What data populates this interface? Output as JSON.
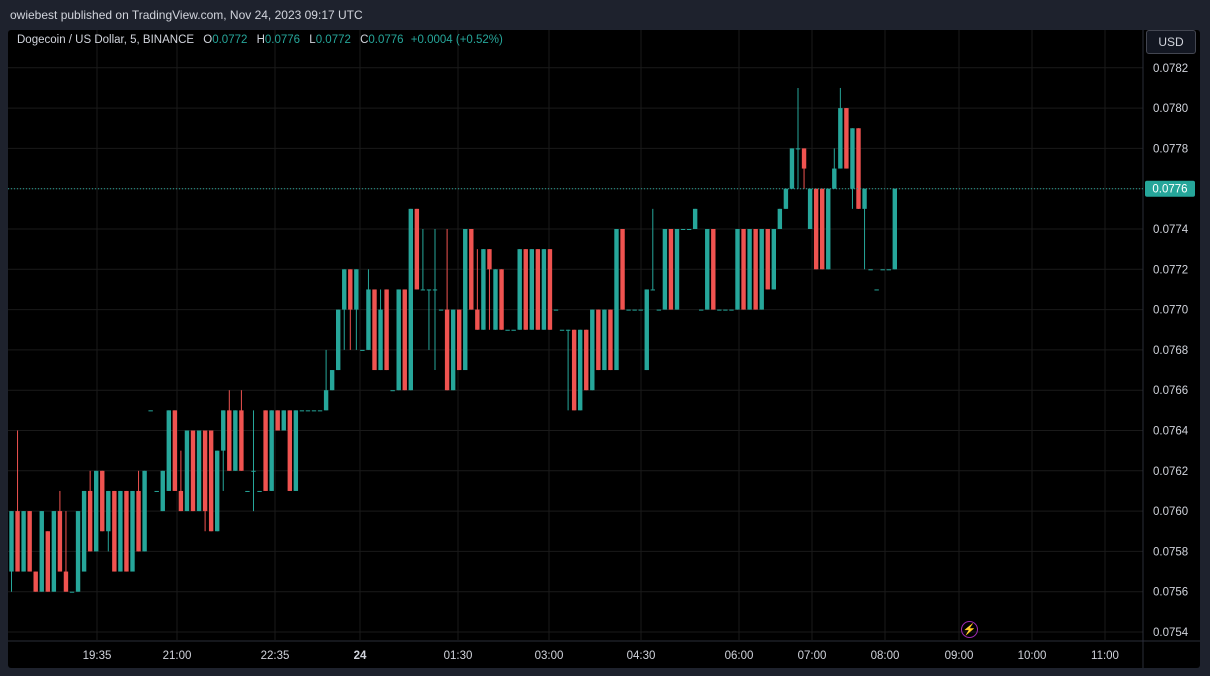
{
  "header": {
    "published": "owiebest published on TradingView.com, Nov 24, 2023 09:17 UTC"
  },
  "legend": {
    "symbol": "Dogecoin / US Dollar, 5, BINANCE",
    "o_label": "O",
    "o": "0.0772",
    "h_label": "H",
    "h": "0.0776",
    "l_label": "L",
    "l": "0.0772",
    "c_label": "C",
    "c": "0.0776",
    "change": "+0.0004 (+0.52%)"
  },
  "currency_button": "USD",
  "last_price_label": "0.0776",
  "colors": {
    "up": "#26a69a",
    "down": "#ef5350",
    "background": "#000000",
    "grid": "#1a1a1a"
  },
  "icons": {
    "bolt": "lightning-bolt-icon"
  },
  "chart_data": {
    "type": "candlestick",
    "interval": "5",
    "exchange": "BINANCE",
    "ylim": [
      0.0753,
      0.0783
    ],
    "y_ticks": [
      "0.0754",
      "0.0756",
      "0.0758",
      "0.0760",
      "0.0762",
      "0.0764",
      "0.0766",
      "0.0768",
      "0.0770",
      "0.0772",
      "0.0774",
      "0.0776",
      "0.0778",
      "0.0780",
      "0.0782"
    ],
    "x_ticks": [
      "19:35",
      "21:00",
      "22:35",
      "24",
      "01:30",
      "03:00",
      "04:30",
      "06:00",
      "07:00",
      "08:00",
      "09:00",
      "10:00",
      "11:00"
    ],
    "last_price": 0.0776,
    "candles": [
      [
        0.0757,
        0.076,
        0.0756,
        0.076
      ],
      [
        0.076,
        0.0764,
        0.0757,
        0.0757
      ],
      [
        0.0757,
        0.076,
        0.0757,
        0.076
      ],
      [
        0.076,
        0.076,
        0.0757,
        0.0757
      ],
      [
        0.0757,
        0.0757,
        0.0756,
        0.0756
      ],
      [
        0.0756,
        0.076,
        0.0756,
        0.076
      ],
      [
        0.0759,
        0.0759,
        0.0756,
        0.0756
      ],
      [
        0.0756,
        0.076,
        0.0756,
        0.076
      ],
      [
        0.076,
        0.0761,
        0.0757,
        0.0757
      ],
      [
        0.0757,
        0.076,
        0.0756,
        0.0756
      ],
      [
        0.0756,
        0.0756,
        0.0756,
        0.0756
      ],
      [
        0.0756,
        0.076,
        0.0756,
        0.076
      ],
      [
        0.0757,
        0.0761,
        0.0757,
        0.0761
      ],
      [
        0.0761,
        0.0762,
        0.0758,
        0.0758
      ],
      [
        0.0758,
        0.0762,
        0.0758,
        0.0762
      ],
      [
        0.0762,
        0.0762,
        0.0759,
        0.0759
      ],
      [
        0.0759,
        0.0761,
        0.0758,
        0.0761
      ],
      [
        0.0761,
        0.0761,
        0.0757,
        0.0757
      ],
      [
        0.0757,
        0.0761,
        0.0757,
        0.0761
      ],
      [
        0.0761,
        0.0761,
        0.0757,
        0.0757
      ],
      [
        0.0757,
        0.0761,
        0.0757,
        0.0761
      ],
      [
        0.0761,
        0.0762,
        0.0758,
        0.0758
      ],
      [
        0.0758,
        0.0762,
        0.0758,
        0.0762
      ],
      [
        0.0765,
        0.0765,
        0.0765,
        0.0765
      ],
      [
        0.0761,
        0.0761,
        0.0761,
        0.0761
      ],
      [
        0.076,
        0.0762,
        0.076,
        0.0762
      ],
      [
        0.0761,
        0.0765,
        0.0761,
        0.0765
      ],
      [
        0.0765,
        0.0765,
        0.0761,
        0.0761
      ],
      [
        0.0761,
        0.0763,
        0.076,
        0.076
      ],
      [
        0.076,
        0.0764,
        0.076,
        0.0764
      ],
      [
        0.0764,
        0.0764,
        0.076,
        0.076
      ],
      [
        0.076,
        0.0764,
        0.076,
        0.0764
      ],
      [
        0.0764,
        0.0764,
        0.0759,
        0.076
      ],
      [
        0.0764,
        0.0764,
        0.0759,
        0.0759
      ],
      [
        0.0759,
        0.0763,
        0.0759,
        0.0763
      ],
      [
        0.0763,
        0.0765,
        0.0761,
        0.0765
      ],
      [
        0.0765,
        0.0766,
        0.0762,
        0.0762
      ],
      [
        0.0762,
        0.0765,
        0.0762,
        0.0765
      ],
      [
        0.0765,
        0.0766,
        0.0762,
        0.0762
      ],
      [
        0.0761,
        0.0761,
        0.0761,
        0.0761
      ],
      [
        0.0762,
        0.0765,
        0.076,
        0.0762
      ],
      [
        0.0761,
        0.0761,
        0.0761,
        0.0761
      ],
      [
        0.0765,
        0.0765,
        0.0761,
        0.0761
      ],
      [
        0.0761,
        0.0765,
        0.0761,
        0.0765
      ],
      [
        0.0765,
        0.0765,
        0.0764,
        0.0764
      ],
      [
        0.0764,
        0.0765,
        0.0764,
        0.0765
      ],
      [
        0.0765,
        0.0765,
        0.0761,
        0.0761
      ],
      [
        0.0761,
        0.0765,
        0.0761,
        0.0765
      ],
      [
        0.0765,
        0.0765,
        0.0765,
        0.0765
      ],
      [
        0.0765,
        0.0765,
        0.0765,
        0.0765
      ],
      [
        0.0765,
        0.0765,
        0.0765,
        0.0765
      ],
      [
        0.0765,
        0.0765,
        0.0765,
        0.0765
      ],
      [
        0.0765,
        0.0768,
        0.0765,
        0.0766
      ],
      [
        0.0766,
        0.0767,
        0.0766,
        0.0767
      ],
      [
        0.0767,
        0.077,
        0.0767,
        0.077
      ],
      [
        0.077,
        0.0772,
        0.0768,
        0.0772
      ],
      [
        0.0772,
        0.0772,
        0.0768,
        0.077
      ],
      [
        0.077,
        0.0772,
        0.0768,
        0.0772
      ],
      [
        0.0768,
        0.0768,
        0.0768,
        0.0768
      ],
      [
        0.0768,
        0.0772,
        0.0768,
        0.0771
      ],
      [
        0.0771,
        0.0771,
        0.0767,
        0.0767
      ],
      [
        0.0767,
        0.0771,
        0.0767,
        0.077
      ],
      [
        0.0771,
        0.0771,
        0.0767,
        0.0767
      ],
      [
        0.0766,
        0.0766,
        0.0766,
        0.0766
      ],
      [
        0.0766,
        0.0771,
        0.0766,
        0.0771
      ],
      [
        0.0771,
        0.0771,
        0.0766,
        0.0766
      ],
      [
        0.0766,
        0.0775,
        0.0766,
        0.0775
      ],
      [
        0.0775,
        0.0775,
        0.0771,
        0.0771
      ],
      [
        0.0771,
        0.0774,
        0.0771,
        0.0771
      ],
      [
        0.0771,
        0.0771,
        0.0768,
        0.0771
      ],
      [
        0.0771,
        0.0774,
        0.0767,
        0.0771
      ],
      [
        0.077,
        0.077,
        0.077,
        0.077
      ],
      [
        0.077,
        0.0774,
        0.0766,
        0.0766
      ],
      [
        0.0766,
        0.077,
        0.0766,
        0.077
      ],
      [
        0.077,
        0.077,
        0.0767,
        0.0767
      ],
      [
        0.0767,
        0.0774,
        0.0767,
        0.0774
      ],
      [
        0.0774,
        0.0774,
        0.077,
        0.077
      ],
      [
        0.077,
        0.0773,
        0.0769,
        0.0769
      ],
      [
        0.0769,
        0.0773,
        0.0769,
        0.0773
      ],
      [
        0.0773,
        0.0773,
        0.0769,
        0.0772
      ],
      [
        0.0769,
        0.0772,
        0.0769,
        0.0772
      ],
      [
        0.0772,
        0.0772,
        0.0769,
        0.0769
      ],
      [
        0.0769,
        0.0769,
        0.0769,
        0.0769
      ],
      [
        0.0769,
        0.0769,
        0.0769,
        0.0769
      ],
      [
        0.0769,
        0.0773,
        0.0769,
        0.0773
      ],
      [
        0.0773,
        0.0773,
        0.0769,
        0.0769
      ],
      [
        0.0769,
        0.0773,
        0.0769,
        0.0773
      ],
      [
        0.0773,
        0.0773,
        0.0769,
        0.0769
      ],
      [
        0.0769,
        0.0773,
        0.0769,
        0.0773
      ],
      [
        0.0773,
        0.0773,
        0.0769,
        0.0769
      ],
      [
        0.077,
        0.077,
        0.077,
        0.077
      ],
      [
        0.0769,
        0.0769,
        0.0769,
        0.0769
      ],
      [
        0.0769,
        0.0769,
        0.0765,
        0.0769
      ],
      [
        0.0769,
        0.0769,
        0.0765,
        0.0765
      ],
      [
        0.0765,
        0.0769,
        0.0765,
        0.0769
      ],
      [
        0.0769,
        0.0769,
        0.0766,
        0.0766
      ],
      [
        0.0766,
        0.077,
        0.0766,
        0.077
      ],
      [
        0.077,
        0.077,
        0.0767,
        0.0767
      ],
      [
        0.0767,
        0.077,
        0.0767,
        0.077
      ],
      [
        0.077,
        0.077,
        0.0767,
        0.0767
      ],
      [
        0.0767,
        0.0774,
        0.0767,
        0.0774
      ],
      [
        0.0774,
        0.0774,
        0.077,
        0.077
      ],
      [
        0.077,
        0.077,
        0.077,
        0.077
      ],
      [
        0.077,
        0.077,
        0.077,
        0.077
      ],
      [
        0.077,
        0.077,
        0.077,
        0.077
      ],
      [
        0.0767,
        0.0771,
        0.0767,
        0.0771
      ],
      [
        0.0771,
        0.0775,
        0.0771,
        0.0771
      ],
      [
        0.077,
        0.077,
        0.077,
        0.077
      ],
      [
        0.077,
        0.0774,
        0.077,
        0.0774
      ],
      [
        0.0774,
        0.0774,
        0.077,
        0.077
      ],
      [
        0.077,
        0.0774,
        0.077,
        0.0774
      ],
      [
        0.0774,
        0.0774,
        0.0774,
        0.0774
      ],
      [
        0.0774,
        0.0774,
        0.0774,
        0.0774
      ],
      [
        0.0774,
        0.0775,
        0.0774,
        0.0775
      ],
      [
        0.077,
        0.077,
        0.077,
        0.077
      ],
      [
        0.077,
        0.0774,
        0.077,
        0.0774
      ],
      [
        0.0774,
        0.0774,
        0.077,
        0.077
      ],
      [
        0.077,
        0.077,
        0.077,
        0.077
      ],
      [
        0.077,
        0.077,
        0.077,
        0.077
      ],
      [
        0.077,
        0.077,
        0.077,
        0.077
      ],
      [
        0.077,
        0.0774,
        0.077,
        0.0774
      ],
      [
        0.0774,
        0.0774,
        0.077,
        0.077
      ],
      [
        0.077,
        0.0774,
        0.077,
        0.0774
      ],
      [
        0.0774,
        0.0774,
        0.077,
        0.077
      ],
      [
        0.077,
        0.0774,
        0.077,
        0.0774
      ],
      [
        0.0774,
        0.0774,
        0.0771,
        0.0771
      ],
      [
        0.0771,
        0.0774,
        0.0771,
        0.0774
      ],
      [
        0.0774,
        0.0775,
        0.0774,
        0.0775
      ],
      [
        0.0775,
        0.0776,
        0.0775,
        0.0776
      ],
      [
        0.0776,
        0.0778,
        0.0776,
        0.0778
      ],
      [
        0.0778,
        0.0781,
        0.0776,
        0.0778
      ],
      [
        0.0778,
        0.0778,
        0.0776,
        0.0777
      ],
      [
        0.0774,
        0.0776,
        0.0774,
        0.0776
      ],
      [
        0.0776,
        0.0776,
        0.0772,
        0.0772
      ],
      [
        0.0776,
        0.0776,
        0.0772,
        0.0772
      ],
      [
        0.0772,
        0.0776,
        0.0772,
        0.0776
      ],
      [
        0.0776,
        0.0778,
        0.0776,
        0.0777
      ],
      [
        0.0777,
        0.0781,
        0.0777,
        0.078
      ],
      [
        0.078,
        0.078,
        0.0777,
        0.0777
      ],
      [
        0.0776,
        0.0779,
        0.0775,
        0.0779
      ],
      [
        0.0779,
        0.0779,
        0.0775,
        0.0775
      ],
      [
        0.0775,
        0.0776,
        0.0772,
        0.0776
      ],
      [
        0.0772,
        0.0772,
        0.0772,
        0.0772
      ],
      [
        0.0771,
        0.0771,
        0.0771,
        0.0771
      ],
      [
        0.0772,
        0.0772,
        0.0772,
        0.0772
      ],
      [
        0.0772,
        0.0772,
        0.0772,
        0.0772
      ],
      [
        0.0772,
        0.0776,
        0.0772,
        0.0776
      ]
    ]
  }
}
